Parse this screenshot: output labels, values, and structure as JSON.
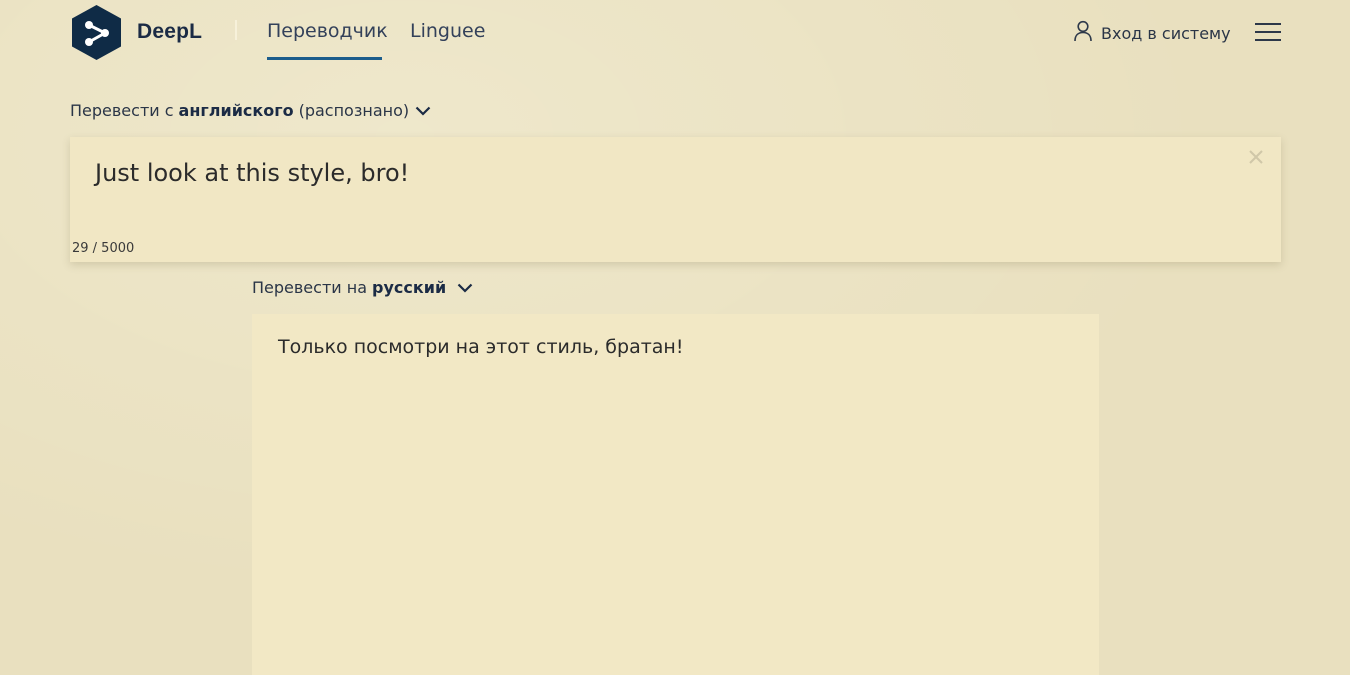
{
  "brand": {
    "name": "DeepL"
  },
  "nav": {
    "tabs": [
      {
        "label": "Переводчик",
        "active": true
      },
      {
        "label": "Linguee",
        "active": false
      }
    ],
    "login_label": "Вход в систему"
  },
  "source": {
    "prefix": "Перевести с",
    "language": "английского",
    "suffix": "(распознано)",
    "text": "Just look at this style, bro!",
    "char_count": "29 / 5000"
  },
  "target": {
    "prefix": "Перевести на",
    "language": "русский",
    "text": "Только посмотри на этот стиль, братан!"
  },
  "colors": {
    "background": "#e9e0bf",
    "panel": "#f1e7c4",
    "brand": "#0f2b46",
    "accent": "#1c5d8c"
  },
  "icons": {
    "logo": "deepl-logo-icon",
    "user": "user-icon",
    "menu": "hamburger-menu-icon",
    "chevron": "chevron-down-icon",
    "clear": "close-icon"
  }
}
